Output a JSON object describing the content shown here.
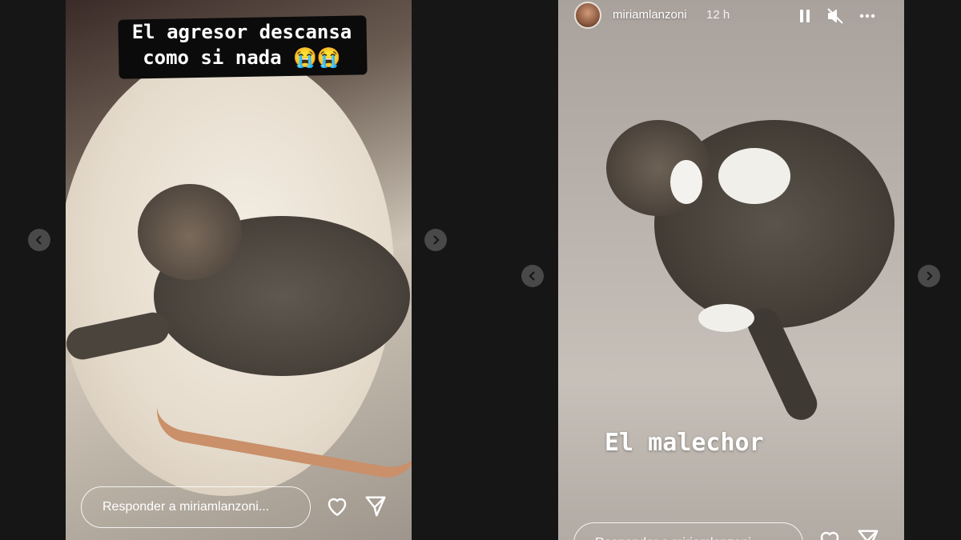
{
  "story_left": {
    "caption_line1": "El agresor descansa",
    "caption_line2": "como si nada 😭😭",
    "reply_placeholder": "Responder a miriamlanzoni..."
  },
  "story_right": {
    "username": "miriamlanzoni",
    "time": "12 h",
    "caption": "El malechor",
    "reply_placeholder": "Responder a miriamlanzoni..."
  },
  "icons": {
    "pause": "pause-icon",
    "mute": "mute-icon",
    "more": "more-icon",
    "heart": "heart-icon",
    "send": "send-icon",
    "prev": "chevron-left-icon",
    "next": "chevron-right-icon"
  }
}
